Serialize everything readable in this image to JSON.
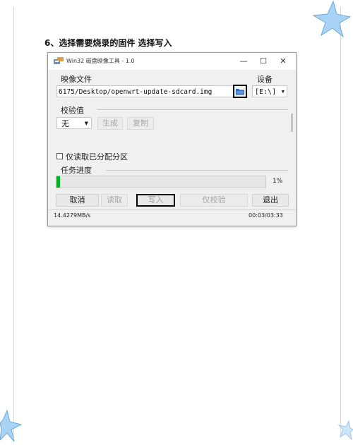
{
  "heading": "6、选择需要烧录的固件  选择写入",
  "window": {
    "title": "Win32 磁盘映像工具 - 1.0",
    "minimize_glyph": "—",
    "maximize_glyph": "☐",
    "close_glyph": "✕"
  },
  "image_file": {
    "label": "映像文件",
    "path": "6175/Desktop/openwrt-update-sdcard.img"
  },
  "device": {
    "label": "设备",
    "value": "[E:\\]",
    "arrow": "▼"
  },
  "hash": {
    "label": "校验值",
    "select_value": "无",
    "arrow": "▼",
    "generate_label": "生成",
    "copy_label": "复制"
  },
  "readonly_label": "仅读取已分配分区",
  "progress": {
    "label": "任务进度",
    "percent_text": "1%",
    "fraction": 0.01
  },
  "buttons": {
    "cancel": "取消",
    "read": "读取",
    "write": "写入",
    "verify": "仅校验",
    "exit": "退出"
  },
  "status": {
    "speed": "14.4279MB/s",
    "time": "00:03/03:33"
  },
  "colors": {
    "progress_fill": "#06b025",
    "folder_icon": "#2b6cc4",
    "star": "#8fc3ef"
  },
  "icons": {
    "folder": "folder-icon",
    "app": "disk-imager-icon"
  }
}
